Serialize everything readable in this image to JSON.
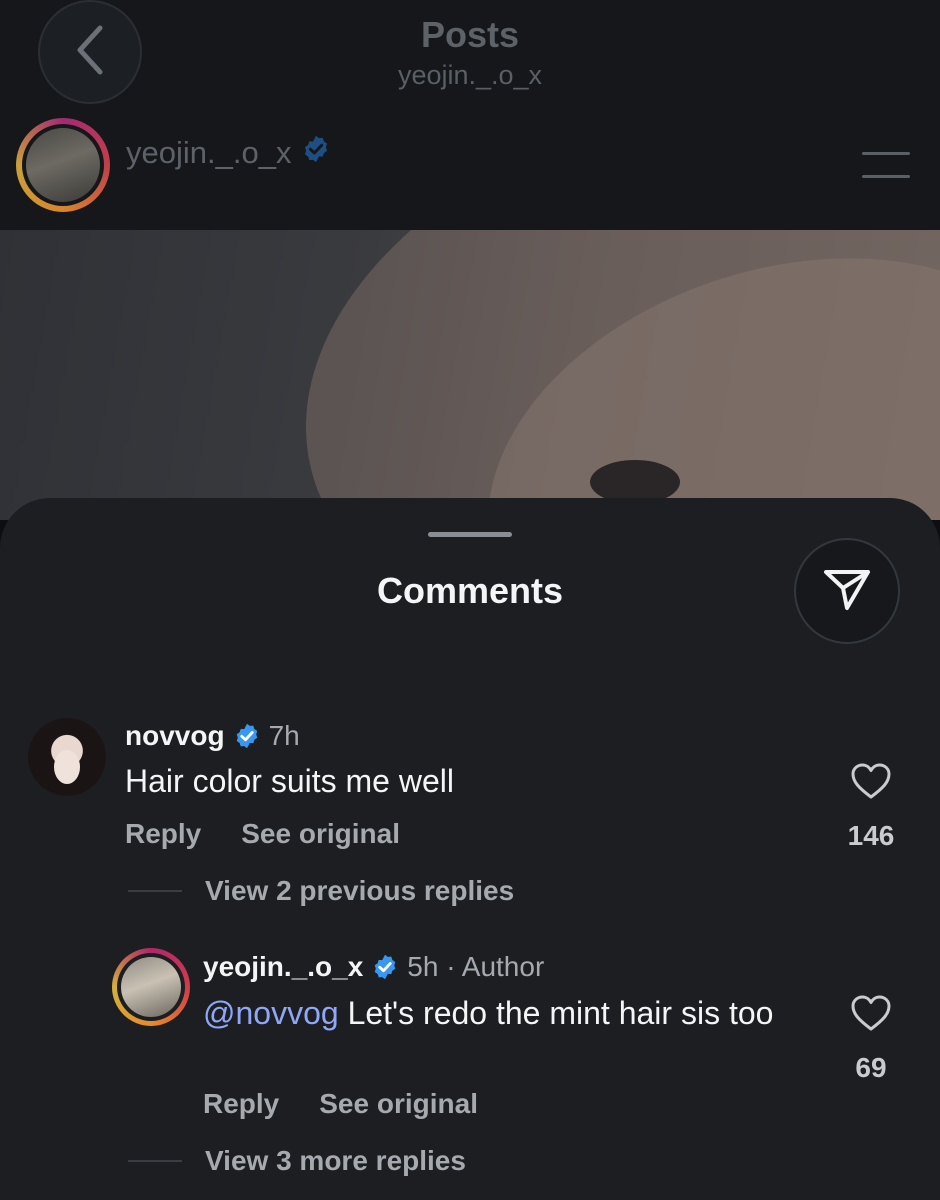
{
  "header": {
    "title": "Posts",
    "subtitle": "yeojin._.o_x"
  },
  "post": {
    "author": "yeojin._.o_x"
  },
  "sheet": {
    "title": "Comments"
  },
  "comments": [
    {
      "user": "novvog",
      "time": "7h",
      "text": "Hair color suits me well",
      "reply_label": "Reply",
      "see_original_label": "See original",
      "likes": "146",
      "view_replies": "View 2 previous replies"
    },
    {
      "user": "yeojin._.o_x",
      "time": "5h · Author",
      "mention": "@novvog",
      "text": " Let's redo the mint hair sis too",
      "reply_label": "Reply",
      "see_original_label": "See original",
      "likes": "69",
      "view_replies": "View 3 more replies"
    }
  ],
  "colors": {
    "sheet_bg": "#1c1e22",
    "mention": "#8fa7f7",
    "verified": "#3897f0",
    "muted_text": "#a6a9ae"
  },
  "icons": [
    "back-chevron-icon",
    "verified-badge-icon",
    "menu-icon",
    "share-icon",
    "heart-icon"
  ]
}
